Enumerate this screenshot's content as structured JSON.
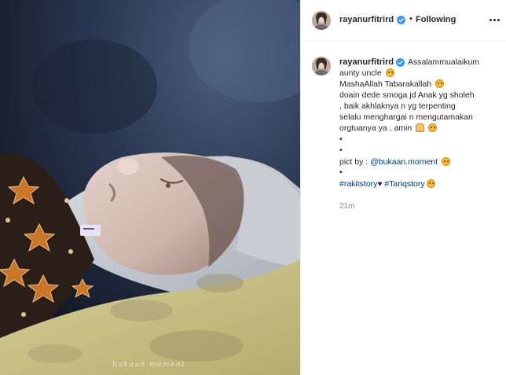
{
  "header": {
    "username": "rayanurfitrird",
    "separator": "•",
    "follow_label": "Following",
    "more_icon": "ellipsis-icon"
  },
  "caption": {
    "username": "rayanurfitrird",
    "line1": "Assalammualaikum",
    "line2": "aunty uncle",
    "line3": "MashaAllah Tabarakallah",
    "line4": "doain dede smoga jd Anak yg sholeh",
    "line5": ", baik akhlaknya n yg terpenting",
    "line6": "selalu menghargai n mengutamakan",
    "line7": "orgtuanya ya , amin",
    "dot1": "•",
    "dot2": "•",
    "pict_prefix": "pict by : ",
    "pict_mention": "@bukaan.moment",
    "dot3": "•",
    "tag1": "#rakitstory",
    "heart": "♥",
    "tag2": "#Tariqstory"
  },
  "timestamp": "21m",
  "photo": {
    "watermark": "bukaan.moment"
  },
  "colors": {
    "link": "#00376b",
    "muted": "#8e8e8e",
    "verified": "#3897f0",
    "text": "#262626"
  }
}
